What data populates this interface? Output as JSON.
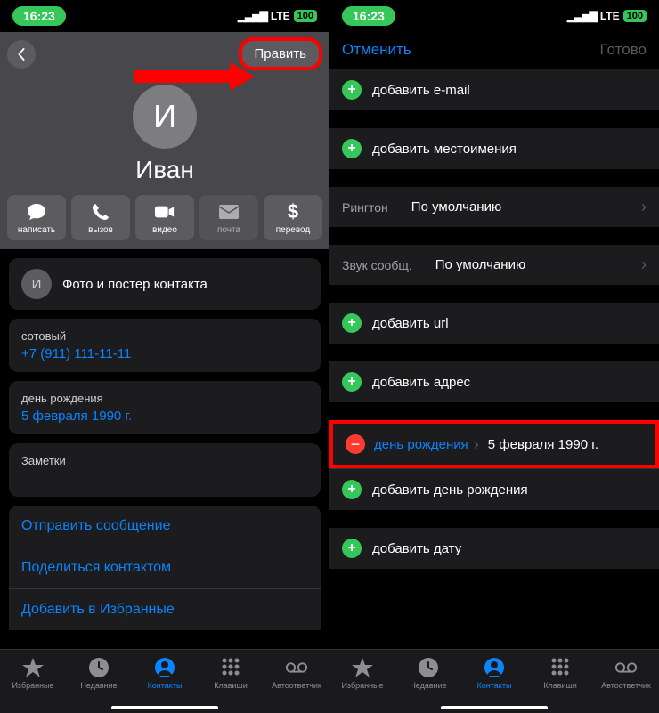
{
  "status": {
    "time": "16:23",
    "net": "LTE",
    "battery": "100"
  },
  "left": {
    "edit_label": "Править",
    "avatar_initial": "И",
    "name": "Иван",
    "actions": {
      "write": "написать",
      "call": "вызов",
      "video": "видео",
      "mail": "почта",
      "pay": "перевод"
    },
    "photo_poster": "Фото и постер контакта",
    "mobile_label": "сотовый",
    "mobile_value": "+7 (911) 111-11-11",
    "birthday_label": "день рождения",
    "birthday_value": "5 февраля 1990 г.",
    "notes_label": "Заметки",
    "links": {
      "send_message": "Отправить сообщение",
      "share_contact": "Поделиться контактом",
      "add_favorite": "Добавить в Избранные"
    }
  },
  "right": {
    "cancel": "Отменить",
    "done": "Готово",
    "add_email": "добавить e-mail",
    "add_pronouns": "добавить местоимения",
    "ringtone_label": "Рингтон",
    "ringtone_value": "По умолчанию",
    "textsound_label": "Звук сообщ.",
    "textsound_value": "По умолчанию",
    "add_url": "добавить url",
    "add_address": "добавить адрес",
    "birthday_key": "день рождения",
    "birthday_val": "5 февраля 1990 г.",
    "add_birthday": "добавить день рождения",
    "add_date": "добавить дату"
  },
  "tabs": {
    "favorites": "Избранные",
    "recents": "Недавние",
    "contacts": "Контакты",
    "keypad": "Клавиши",
    "voicemail": "Автоответчик"
  }
}
